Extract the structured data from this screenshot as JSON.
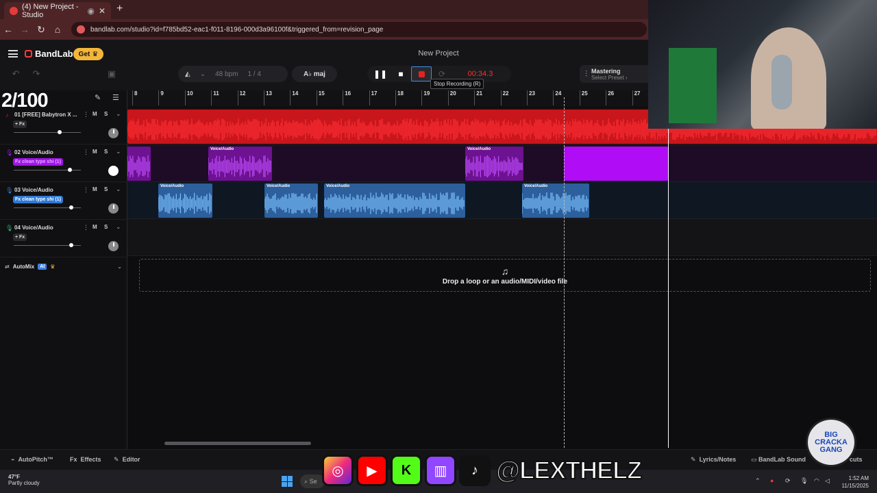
{
  "browser": {
    "tab_title": "(4) New Project - Studio",
    "new_tab": "+",
    "url": "bandlab.com/studio?id=f785bd52-eac1-f011-8196-000d3a96100f&triggered_from=revision_page"
  },
  "app": {
    "logo": "BandLab",
    "get_label": "Get",
    "project_title": "New Project",
    "bpm_value": "48",
    "bpm_unit": "bpm",
    "time_sig_num": "1",
    "time_sig_den": "4",
    "key": "A♭ maj",
    "timer": "00:34.3",
    "tooltip": "Stop Recording (R)",
    "mastering_title": "Mastering",
    "mastering_sub": "Select Preset"
  },
  "overlay_counter": "2/100",
  "ruler": [
    "8",
    "9",
    "10",
    "11",
    "12",
    "13",
    "14",
    "15",
    "16",
    "17",
    "18",
    "19",
    "20",
    "21",
    "22",
    "23",
    "24",
    "25",
    "26",
    "27"
  ],
  "tracks": [
    {
      "name": "01  [FREE] Babytron X ...",
      "fx": "+ Fx",
      "color": "#e11c22"
    },
    {
      "name": "02  Voice/Audio",
      "fx": "Fx clean type shi (1)",
      "color": "#a214e8"
    },
    {
      "name": "03  Voice/Audio",
      "fx": "Fx clean type shi (1)",
      "color": "#2f7ad6"
    },
    {
      "name": "04  Voice/Audio",
      "fx": "+ Fx",
      "color": "#2bb673"
    }
  ],
  "track_buttons": {
    "mute": "M",
    "solo": "S"
  },
  "clip_label": "Voice/Audio",
  "automix": {
    "label": "AutoMix",
    "ai": "AI"
  },
  "dropzone": "Drop a loop or an audio/MIDI/video file",
  "bottom": {
    "autopitch": "AutoPitch™",
    "effects": "Effects",
    "editor": "Editor",
    "lyrics": "Lyrics/Notes",
    "sounds": "BandLab Sound",
    "shortcuts": "cuts"
  },
  "taskbar": {
    "temp": "47°F",
    "weather": "Partly cloudy",
    "search": "Se",
    "time": "1:52 AM",
    "date": "11/15/2025"
  },
  "social_handle": "@LEXTHELZ",
  "badge_text": "BIG CRACKA GANG"
}
